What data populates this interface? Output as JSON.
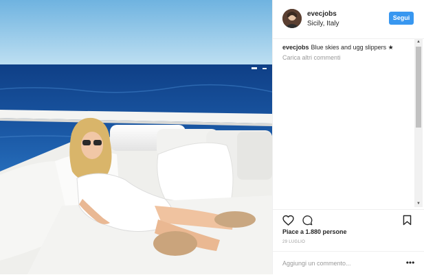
{
  "post": {
    "username": "evecjobs",
    "location": "Sicily, Italy",
    "follow_label": "Segui",
    "caption_user": "evecjobs",
    "caption_text": "Blue skies and ugg slippers",
    "caption_emoji": "★",
    "more_comments_label": "Carica altri commenti",
    "likes": "Piace a 1.880 persone",
    "date": "29 LUGLIO",
    "comment_placeholder": "Aggiungi un commento...",
    "options_glyph": "•••"
  },
  "icons": {
    "like": "heart-icon",
    "comment": "comment-icon",
    "save": "bookmark-icon",
    "options": "more-options-icon"
  },
  "colors": {
    "follow_button": "#3897f0",
    "muted_text": "#999999",
    "border": "#efefef"
  }
}
